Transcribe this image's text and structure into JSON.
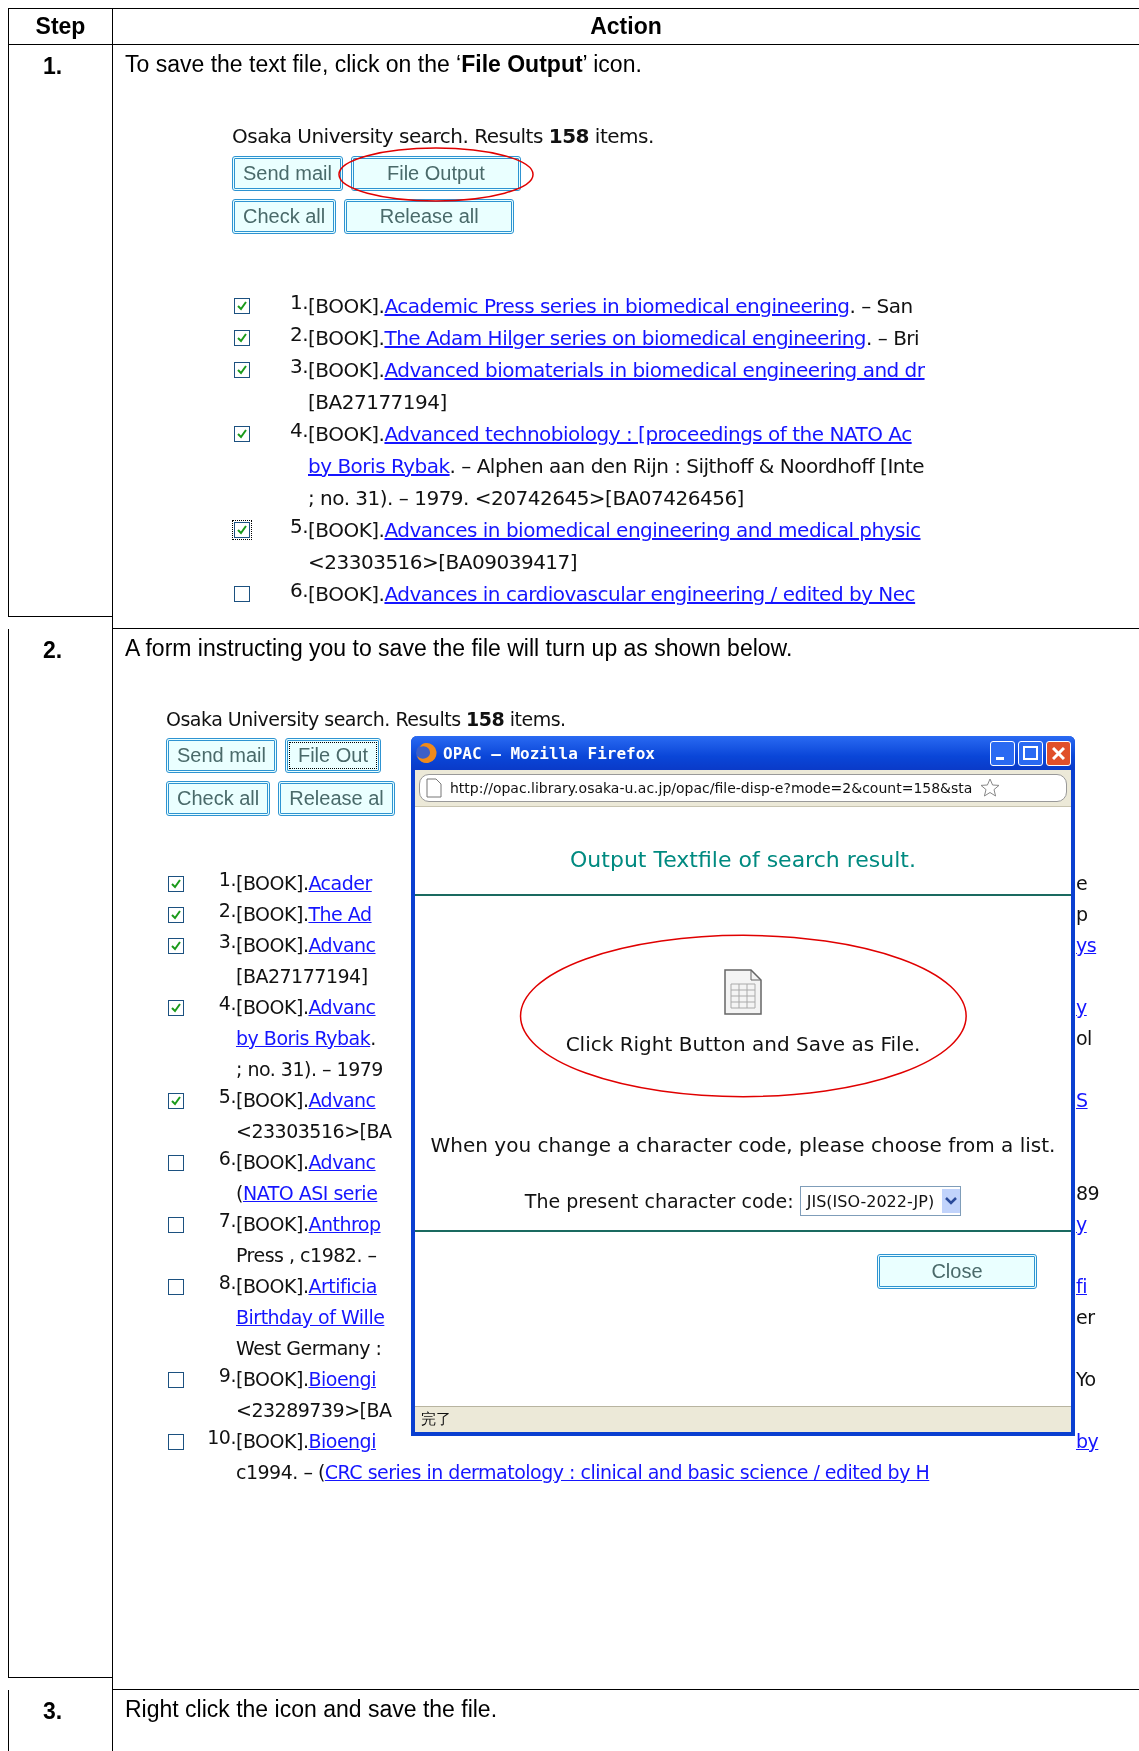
{
  "table": {
    "columns": [
      "Step",
      "Action"
    ],
    "rows": [
      {
        "step": "1.",
        "instruction": "To save the text file, click on the ‘**File Output**’ icon.",
        "screenshot": {
          "summary": "Osaka University search. Results **158** items.",
          "buttons": [
            {
              "label": "Send mail",
              "focused": false,
              "circled": false
            },
            {
              "label": "File Output",
              "focused": false,
              "circled": true
            },
            {
              "label": "Check all",
              "focused": false,
              "circled": false
            },
            {
              "label": "Release all",
              "focused": false,
              "circled": false
            }
          ],
          "results": [
            {
              "checked": true,
              "focused": false,
              "num": "1.",
              "lines": [
                {
                  "parts": [
                    {
                      "kind": "plain",
                      "text": "[BOOK]."
                    },
                    {
                      "kind": "link",
                      "text": "Academic Press series in biomedical engineering"
                    },
                    {
                      "kind": "plain",
                      "text": ". – San"
                    }
                  ]
                }
              ]
            },
            {
              "checked": true,
              "focused": false,
              "num": "2.",
              "lines": [
                {
                  "parts": [
                    {
                      "kind": "plain",
                      "text": "[BOOK]."
                    },
                    {
                      "kind": "link",
                      "text": "The Adam Hilger series on biomedical engineering"
                    },
                    {
                      "kind": "plain",
                      "text": ". – Bri"
                    }
                  ]
                }
              ]
            },
            {
              "checked": true,
              "focused": false,
              "num": "3.",
              "lines": [
                {
                  "parts": [
                    {
                      "kind": "plain",
                      "text": "[BOOK]."
                    },
                    {
                      "kind": "link",
                      "text": "Advanced biomaterials in biomedical engineering and dr"
                    }
                  ]
                },
                {
                  "parts": [
                    {
                      "kind": "plain",
                      "text": "[BA27177194]"
                    }
                  ]
                }
              ]
            },
            {
              "checked": true,
              "focused": false,
              "num": "4.",
              "lines": [
                {
                  "parts": [
                    {
                      "kind": "plain",
                      "text": "[BOOK]."
                    },
                    {
                      "kind": "link",
                      "text": "Advanced technobiology : [proceedings of the NATO Ac"
                    }
                  ]
                },
                {
                  "parts": [
                    {
                      "kind": "link",
                      "text": "by Boris Rybak"
                    },
                    {
                      "kind": "plain",
                      "text": ". – Alphen aan den Rijn : Sijthoff & Noordhoff [Inte"
                    }
                  ]
                },
                {
                  "parts": [
                    {
                      "kind": "plain",
                      "text": "; no. 31). – 1979. <20742645>[BA07426456]"
                    }
                  ]
                }
              ]
            },
            {
              "checked": true,
              "focused": true,
              "num": "5.",
              "lines": [
                {
                  "parts": [
                    {
                      "kind": "plain",
                      "text": "[BOOK]."
                    },
                    {
                      "kind": "link",
                      "text": "Advances in biomedical engineering and medical physic"
                    }
                  ]
                },
                {
                  "parts": [
                    {
                      "kind": "plain",
                      "text": "<23303516>[BA09039417]"
                    }
                  ]
                }
              ]
            },
            {
              "checked": false,
              "focused": false,
              "num": "6.",
              "lines": [
                {
                  "parts": [
                    {
                      "kind": "plain",
                      "text": "[BOOK]."
                    },
                    {
                      "kind": "link",
                      "text": "Advances in cardiovascular engineering / edited by Nec"
                    }
                  ]
                }
              ]
            }
          ]
        }
      },
      {
        "step": "2.",
        "instruction": "A form instructing you to save the file will turn up as shown below.",
        "screenshot": {
          "summary": "Osaka University search. Results **158** items.",
          "buttons": [
            {
              "label": "Send mail",
              "focused": false,
              "circled": false
            },
            {
              "label": "File Out",
              "focused": true,
              "circled": false
            },
            {
              "label": "Check all",
              "focused": false,
              "circled": false
            },
            {
              "label": "Release al",
              "focused": false,
              "circled": false
            }
          ],
          "results": [
            {
              "checked": true,
              "focused": false,
              "num": "1.",
              "lines": [
                {
                  "parts": [
                    {
                      "kind": "plain",
                      "text": "[BOOK]."
                    },
                    {
                      "kind": "link",
                      "text": "Acader"
                    }
                  ],
                  "right": [
                    {
                      "kind": "plain",
                      "text": "e"
                    }
                  ]
                }
              ]
            },
            {
              "checked": true,
              "focused": false,
              "num": "2.",
              "lines": [
                {
                  "parts": [
                    {
                      "kind": "plain",
                      "text": "[BOOK]."
                    },
                    {
                      "kind": "link",
                      "text": "The Ad"
                    }
                  ],
                  "right": [
                    {
                      "kind": "plain",
                      "text": "p"
                    }
                  ]
                }
              ]
            },
            {
              "checked": true,
              "focused": false,
              "num": "3.",
              "lines": [
                {
                  "parts": [
                    {
                      "kind": "plain",
                      "text": "[BOOK]."
                    },
                    {
                      "kind": "link",
                      "text": "Advanc"
                    }
                  ],
                  "right": [
                    {
                      "kind": "link",
                      "text": "ys"
                    }
                  ]
                },
                {
                  "parts": [
                    {
                      "kind": "plain",
                      "text": "[BA27177194]"
                    }
                  ]
                }
              ]
            },
            {
              "checked": true,
              "focused": false,
              "num": "4.",
              "lines": [
                {
                  "parts": [
                    {
                      "kind": "plain",
                      "text": "[BOOK]."
                    },
                    {
                      "kind": "link",
                      "text": "Advanc"
                    }
                  ],
                  "right": [
                    {
                      "kind": "link",
                      "text": "y"
                    }
                  ]
                },
                {
                  "parts": [
                    {
                      "kind": "link",
                      "text": "by Boris Rybak"
                    },
                    {
                      "kind": "plain",
                      "text": "."
                    }
                  ],
                  "right": [
                    {
                      "kind": "plain",
                      "text": "ol"
                    }
                  ]
                },
                {
                  "parts": [
                    {
                      "kind": "plain",
                      "text": "; no. 31). – 1979"
                    }
                  ]
                }
              ]
            },
            {
              "checked": true,
              "focused": false,
              "num": "5.",
              "lines": [
                {
                  "parts": [
                    {
                      "kind": "plain",
                      "text": "[BOOK]."
                    },
                    {
                      "kind": "link",
                      "text": "Advanc"
                    }
                  ],
                  "right": [
                    {
                      "kind": "link",
                      "text": "S"
                    }
                  ]
                },
                {
                  "parts": [
                    {
                      "kind": "plain",
                      "text": "<23303516>[BA"
                    }
                  ]
                }
              ]
            },
            {
              "checked": false,
              "focused": false,
              "num": "6.",
              "lines": [
                {
                  "parts": [
                    {
                      "kind": "plain",
                      "text": "[BOOK]."
                    },
                    {
                      "kind": "link",
                      "text": "Advanc"
                    }
                  ]
                },
                {
                  "parts": [
                    {
                      "kind": "plain",
                      "text": "("
                    },
                    {
                      "kind": "link",
                      "text": "NATO ASI serie"
                    }
                  ],
                  "right": [
                    {
                      "kind": "plain",
                      "text": "89"
                    }
                  ]
                }
              ]
            },
            {
              "checked": false,
              "focused": false,
              "num": "7.",
              "lines": [
                {
                  "parts": [
                    {
                      "kind": "plain",
                      "text": "[BOOK]."
                    },
                    {
                      "kind": "link",
                      "text": "Anthrop"
                    }
                  ],
                  "right": [
                    {
                      "kind": "link",
                      "text": "y"
                    }
                  ]
                },
                {
                  "parts": [
                    {
                      "kind": "plain",
                      "text": "Press , c1982. –"
                    }
                  ]
                }
              ]
            },
            {
              "checked": false,
              "focused": false,
              "num": "8.",
              "lines": [
                {
                  "parts": [
                    {
                      "kind": "plain",
                      "text": "[BOOK]."
                    },
                    {
                      "kind": "link",
                      "text": "Artificia"
                    }
                  ],
                  "right": [
                    {
                      "kind": "link",
                      "text": "fi"
                    }
                  ]
                },
                {
                  "parts": [
                    {
                      "kind": "link",
                      "text": "Birthday of Wille"
                    }
                  ],
                  "right": [
                    {
                      "kind": "plain",
                      "text": "er"
                    }
                  ]
                },
                {
                  "parts": [
                    {
                      "kind": "plain",
                      "text": "West Germany :"
                    }
                  ]
                }
              ]
            },
            {
              "checked": false,
              "focused": false,
              "num": "9.",
              "lines": [
                {
                  "parts": [
                    {
                      "kind": "plain",
                      "text": "[BOOK]."
                    },
                    {
                      "kind": "link",
                      "text": "Bioengi"
                    }
                  ],
                  "right": [
                    {
                      "kind": "plain",
                      "text": "Yo"
                    }
                  ]
                },
                {
                  "parts": [
                    {
                      "kind": "plain",
                      "text": "<23289739>[BA"
                    }
                  ]
                }
              ]
            },
            {
              "checked": false,
              "focused": false,
              "num": "10.",
              "lines": [
                {
                  "parts": [
                    {
                      "kind": "plain",
                      "text": "[BOOK]."
                    },
                    {
                      "kind": "link",
                      "text": "Bioengi"
                    }
                  ],
                  "right": [
                    {
                      "kind": "link",
                      "text": "by"
                    }
                  ]
                },
                {
                  "parts": [
                    {
                      "kind": "plain",
                      "text": "c1994. – ("
                    },
                    {
                      "kind": "link",
                      "text": "CRC series in dermatology : clinical and basic science / edited by H"
                    }
                  ]
                }
              ]
            }
          ],
          "popup": {
            "title": "OPAC – Mozilla Firefox",
            "url": "http://opac.library.osaka-u.ac.jp/opac/file-disp-e?mode=2&count=158&sta",
            "heading": "Output Textfile of search result.",
            "file_caption": "Click Right Button and Save as File.",
            "note": "When you change a character code, please choose from a list.",
            "select_label": "The present character code:",
            "select_value": "JIS(ISO-2022-JP)",
            "close_button": "Close",
            "status": "完了"
          }
        }
      },
      {
        "step": "3.",
        "instruction": "Right click the icon and save the file."
      }
    ]
  }
}
